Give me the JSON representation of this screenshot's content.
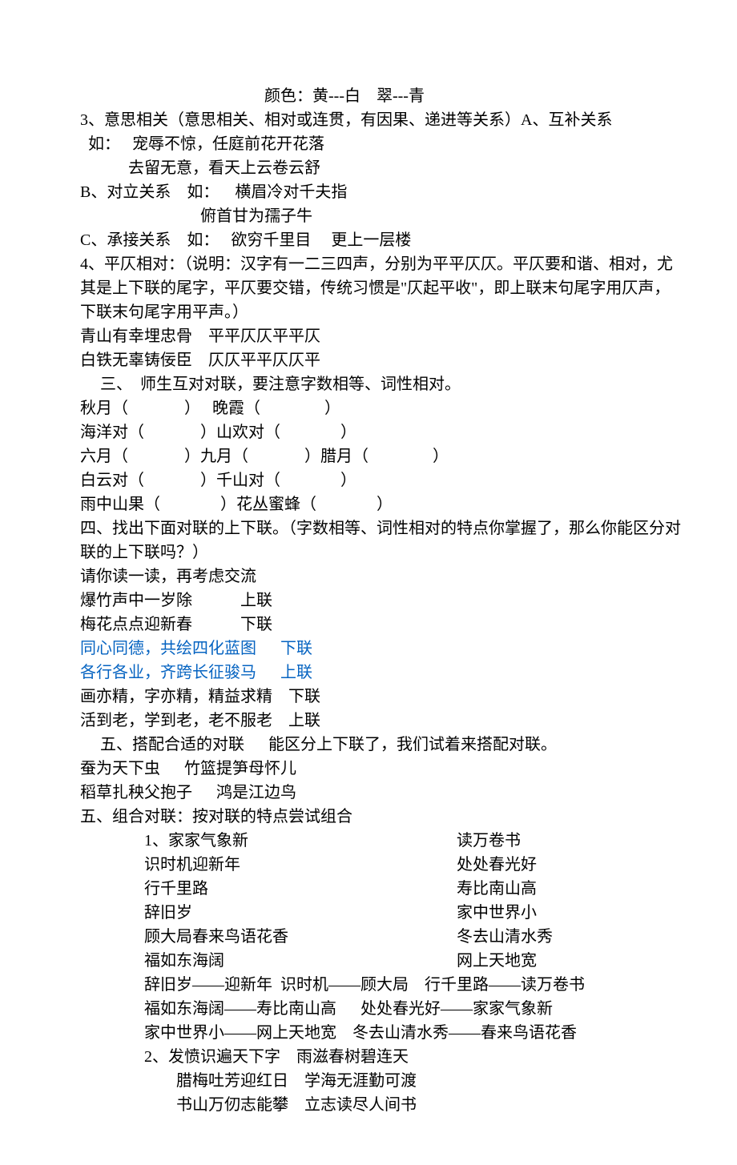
{
  "lines": {
    "l0": "颜色：黄---白　翠---青",
    "l1": "3、意思相关（意思相关、相对或连贯，有因果、递进等关系）A、互补关系",
    "l2": "  如：   宠辱不惊，任庭前花开花落",
    "l3": "            去留无意，看天上云卷云舒",
    "l4": "B、对立关系    如：    横眉冷对千夫指",
    "l5": "                              俯首甘为孺子牛",
    "l6": "C、承接关系    如：   欲穷千里目     更上一层楼",
    "l7": "4、平仄相对：（说明：汉字有一二三四声，分别为平平仄仄。平仄要和谐、相对，尤其是上下联的尾字，平仄要交错，传统习惯是\"仄起平收\"，即上联末句尾字用仄声，下联末句尾字用平声。）",
    "l8": "青山有幸埋忠骨    平平仄仄平平仄",
    "l9": "白铁无辜铸佞臣    仄仄平平仄仄平",
    "l10": "     三、  师生互对对联，要注意字数相等、词性相对。",
    "l11": "秋月（              ）   晚霞（                ）",
    "l12": "海洋对（              ）山欢对（               ）",
    "l13": "六月（              ）九月（              ）腊月（                ）",
    "l14": "白云对（              ）千山对（               ）",
    "l15": "雨中山果（               ）花丛蜜蜂（               ）",
    "l16": "     四、找出下面对联的上下联。（字数相等、词性相对的特点你掌握了，那么你能区分对联的上下联吗？）",
    "l17": "请你读一读，再考虑交流",
    "l18": "爆竹声中一岁除            上联",
    "l19": "梅花点点迎新春            下联",
    "l20": "同心同德，共绘四化蓝图      下联",
    "l21": "各行各业，齐跨长征骏马      上联",
    "l22": "画亦精，字亦精，精益求精    下联",
    "l23": "活到老，学到老，老不服老    上联",
    "l24": "     五、搭配合适的对联      能区分上下联了，我们试着来搭配对联。",
    "l25": "蚕为天下虫      竹篮提笋母怀儿",
    "l26": "稻草扎秧父抱子      鸿是江边鸟",
    "l27": "五、组合对联：按对联的特点尝试组合",
    "p1l": "1、家家气象新",
    "p1r": "读万卷书",
    "p2l": "识时机迎新年",
    "p2r": "处处春光好",
    "p3l": "行千里路",
    "p3r": "寿比南山高",
    "p4l": "辞旧岁",
    "p4r": "家中世界小",
    "p5l": "顾大局春来鸟语花香",
    "p5r": "冬去山清水秀",
    "p6l": "福如东海阔",
    "p6r": "网上天地宽",
    "l28": "辞旧岁——迎新年  识时机——顾大局    行千里路——读万卷书",
    "l29": "福如东海阔——寿比南山高      处处春光好——家家气象新",
    "l30": "家中世界小——网上天地宽    冬去山清水秀——春来鸟语花香",
    "l31": "2、发愤识遍天下字    雨滋春树碧连天",
    "l32": "腊梅吐芳迎红日    学海无涯勤可渡",
    "l33": "书山万仞志能攀    立志读尽人间书"
  }
}
